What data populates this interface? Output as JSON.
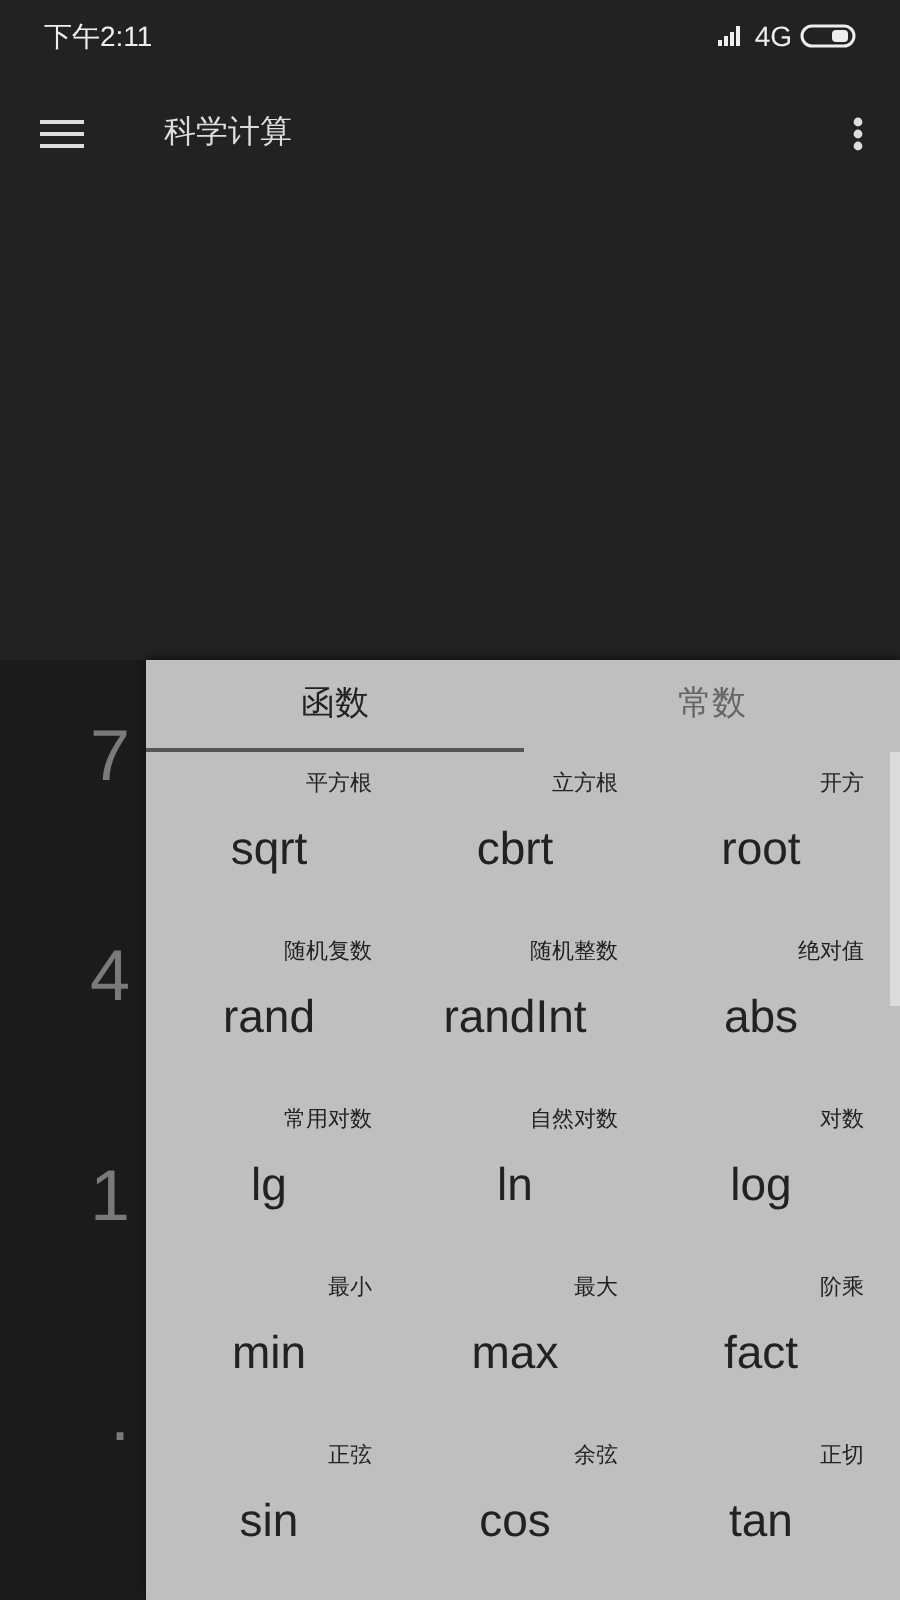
{
  "status_bar": {
    "time": "下午2:11",
    "network": "4G"
  },
  "app_bar": {
    "title": "科学计算"
  },
  "side_keys": [
    "7",
    "4",
    "1",
    "."
  ],
  "tabs": [
    {
      "label": "函数",
      "selected": true
    },
    {
      "label": "常数",
      "selected": false
    }
  ],
  "functions": [
    {
      "hint": "平方根",
      "name": "sqrt"
    },
    {
      "hint": "立方根",
      "name": "cbrt"
    },
    {
      "hint": "开方",
      "name": "root"
    },
    {
      "hint": "随机复数",
      "name": "rand"
    },
    {
      "hint": "随机整数",
      "name": "randInt"
    },
    {
      "hint": "绝对值",
      "name": "abs"
    },
    {
      "hint": "常用对数",
      "name": "lg"
    },
    {
      "hint": "自然对数",
      "name": "ln"
    },
    {
      "hint": "对数",
      "name": "log"
    },
    {
      "hint": "最小",
      "name": "min"
    },
    {
      "hint": "最大",
      "name": "max"
    },
    {
      "hint": "阶乘",
      "name": "fact"
    },
    {
      "hint": "正弦",
      "name": "sin"
    },
    {
      "hint": "余弦",
      "name": "cos"
    },
    {
      "hint": "正切",
      "name": "tan"
    }
  ]
}
